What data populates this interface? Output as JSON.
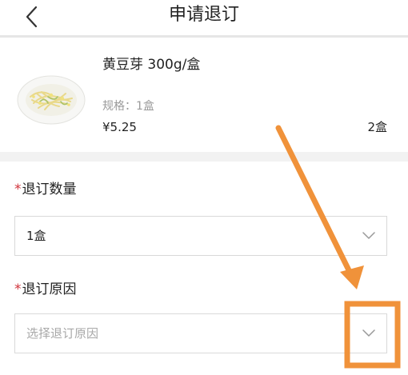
{
  "header": {
    "title": "申请退订",
    "back_icon": "chevron-left-icon"
  },
  "product": {
    "name": "黄豆芽 300g/盒",
    "spec": "规格：1盒",
    "price": "¥5.25",
    "quantity": "2盒",
    "image": "bean-sprouts-plate"
  },
  "form": {
    "required_mark": "*",
    "quantity_label": "退订数量",
    "quantity_value": "1盒",
    "reason_label": "退订原因",
    "reason_placeholder": "选择退订原因",
    "dropdown_icon": "chevron-down-icon"
  },
  "colors": {
    "required": "#d0323a",
    "annotation": "#f0923a",
    "border": "#d9d9d9",
    "section_gap": "#f2f2f2"
  }
}
